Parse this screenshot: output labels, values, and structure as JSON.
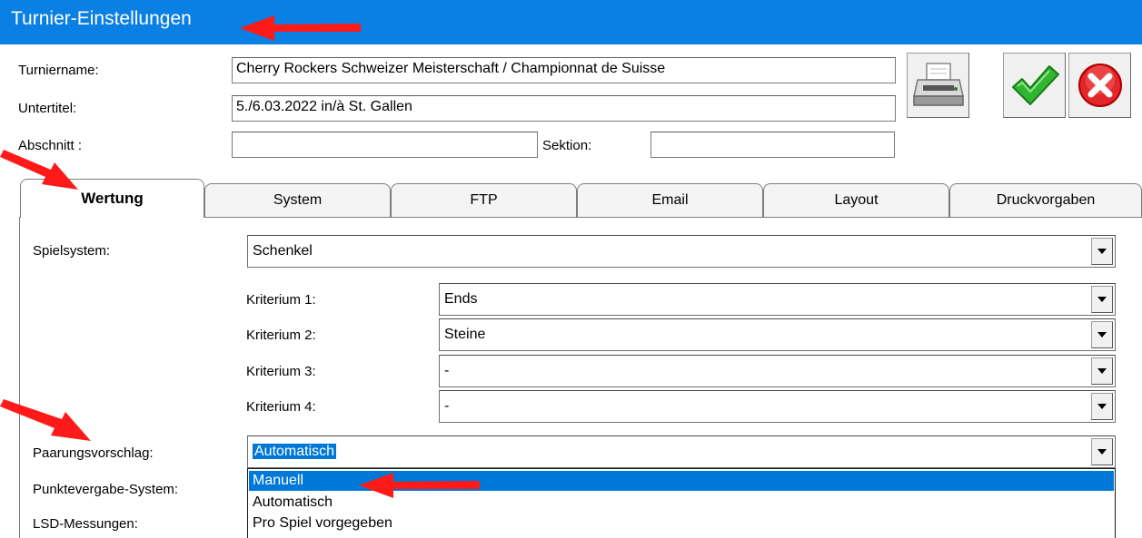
{
  "window": {
    "title": "Turnier-Einstellungen"
  },
  "header": {
    "turniername_label": "Turniername:",
    "turniername_value": "Cherry Rockers Schweizer Meisterschaft / Championnat de Suisse",
    "untertitel_label": "Untertitel:",
    "untertitel_value": "5./6.03.2022 in/à St. Gallen",
    "abschnitt_label": "Abschnitt :",
    "abschnitt_value": "",
    "sektion_label": "Sektion:",
    "sektion_value": ""
  },
  "toolbar": {
    "print_icon": "printer-icon",
    "ok_icon": "checkmark-icon",
    "cancel_icon": "cancel-icon"
  },
  "tabs": [
    {
      "label": "Wertung",
      "active": true
    },
    {
      "label": "System"
    },
    {
      "label": "FTP"
    },
    {
      "label": "Email"
    },
    {
      "label": "Layout"
    },
    {
      "label": "Druckvorgaben"
    }
  ],
  "wertung": {
    "spielsystem_label": "Spielsystem:",
    "spielsystem_value": "Schenkel",
    "kriterien": [
      {
        "label": "Kriterium 1:",
        "value": "Ends"
      },
      {
        "label": "Kriterium 2:",
        "value": "Steine"
      },
      {
        "label": "Kriterium 3:",
        "value": "-"
      },
      {
        "label": "Kriterium 4:",
        "value": "-"
      }
    ],
    "paarung_label": "Paarungsvorschlag:",
    "paarung_value": "Automatisch",
    "paarung_options": [
      "Manuell",
      "Automatisch",
      "Pro Spiel vorgegeben"
    ],
    "paarung_highlighted": "Manuell",
    "punktevergabe_label": "Punktevergabe-System:",
    "lsd_label": "LSD-Messungen:"
  },
  "colors": {
    "titlebar": "#0a7fe4",
    "selection": "#0078d7",
    "annotation_arrow": "#ff0000"
  }
}
